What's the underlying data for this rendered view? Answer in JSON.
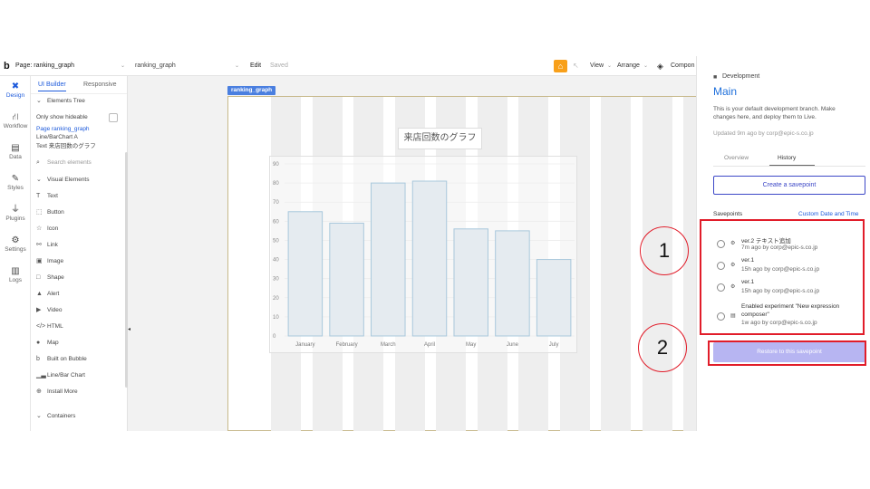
{
  "topbar": {
    "logo": "b",
    "page_label": "Page: ranking_graph",
    "page_select": "ranking_graph",
    "edit": "Edit",
    "saved": "Saved",
    "view": "View",
    "arrange": "Arrange",
    "components": "Compon"
  },
  "rail": [
    {
      "label": "Design",
      "icon": "design-icon",
      "glyph": "✖"
    },
    {
      "label": "Workflow",
      "icon": "workflow-icon",
      "glyph": "⛙"
    },
    {
      "label": "Data",
      "icon": "database-icon",
      "glyph": "▤"
    },
    {
      "label": "Styles",
      "icon": "brush-icon",
      "glyph": "✎"
    },
    {
      "label": "Plugins",
      "icon": "plug-icon",
      "glyph": "⏚"
    },
    {
      "label": "Settings",
      "icon": "gear-icon",
      "glyph": "⚙"
    },
    {
      "label": "Logs",
      "icon": "document-icon",
      "glyph": "▥"
    }
  ],
  "panel": {
    "tab_ui_builder": "UI Builder",
    "tab_responsive": "Responsive",
    "elements_tree": "Elements Tree",
    "only_show_hideable": "Only show hideable",
    "tree_page": "Page ranking_graph",
    "tree_chart": "Line/BarChart A",
    "tree_text": "Text 来店回数のグラフ",
    "search_placeholder": "Search elements",
    "visual_elements": "Visual Elements",
    "items": [
      {
        "label": "Text",
        "icon": "text-icon",
        "glyph": "T"
      },
      {
        "label": "Button",
        "icon": "button-icon",
        "glyph": "⬚"
      },
      {
        "label": "Icon",
        "icon": "star-icon",
        "glyph": "☆"
      },
      {
        "label": "Link",
        "icon": "link-icon",
        "glyph": "⚯"
      },
      {
        "label": "Image",
        "icon": "image-icon",
        "glyph": "▣"
      },
      {
        "label": "Shape",
        "icon": "shape-icon",
        "glyph": "□"
      },
      {
        "label": "Alert",
        "icon": "alert-icon",
        "glyph": "▲"
      },
      {
        "label": "Video",
        "icon": "video-icon",
        "glyph": "▶"
      },
      {
        "label": "HTML",
        "icon": "code-icon",
        "glyph": "</>"
      },
      {
        "label": "Map",
        "icon": "map-pin-icon",
        "glyph": "●"
      },
      {
        "label": "Built on Bubble",
        "icon": "bubble-logo-icon",
        "glyph": "b"
      },
      {
        "label": "Line/Bar Chart",
        "icon": "chart-icon",
        "glyph": "▁▃"
      },
      {
        "label": "Install More",
        "icon": "plus-circle-icon",
        "glyph": "⊕"
      }
    ],
    "containers": "Containers"
  },
  "canvas": {
    "page_tag": "ranking_graph",
    "chart_title": "来店回数のグラフ"
  },
  "chart_data": {
    "type": "bar",
    "categories": [
      "January",
      "February",
      "March",
      "April",
      "May",
      "June",
      "July"
    ],
    "values": [
      65,
      59,
      80,
      81,
      56,
      55,
      40
    ],
    "ylim": [
      0,
      90
    ],
    "yticks": [
      0,
      10,
      20,
      30,
      40,
      50,
      60,
      70,
      80,
      90
    ],
    "grid": true,
    "bar_fill": "#e5ebf0",
    "bar_stroke": "#a9c8dc"
  },
  "right_panel": {
    "branch_label": "Development",
    "branch_name": "Main",
    "desc_line1": "This is your default development branch. Make",
    "desc_line2": "changes here, and deploy them to Live.",
    "updated": "Updated 9m ago by corp@epic-s.co.jp",
    "tab_overview": "Overview",
    "tab_history": "History",
    "create_savepoint": "Create a savepoint",
    "savepoints": "Savepoints",
    "custom_date": "Custom Date and Time",
    "items": [
      {
        "title": "ver.2 テキスト追加",
        "meta": "7m ago by corp@epic-s.co.jp",
        "icon": "savepoint-icon"
      },
      {
        "title": "ver.1",
        "meta": "15h ago by corp@epic-s.co.jp",
        "icon": "savepoint-icon"
      },
      {
        "title": "ver.1",
        "meta": "15h ago by corp@epic-s.co.jp",
        "icon": "savepoint-icon"
      },
      {
        "title": "Enabled experiment \"New expression",
        "title2": "composer\"",
        "meta": "1w ago by corp@epic-s.co.jp",
        "icon": "experiment-icon"
      }
    ],
    "restore": "Restore to this savepoint"
  },
  "annotations": {
    "callout1": "1",
    "callout2": "2",
    "color": "#e11d2a"
  }
}
